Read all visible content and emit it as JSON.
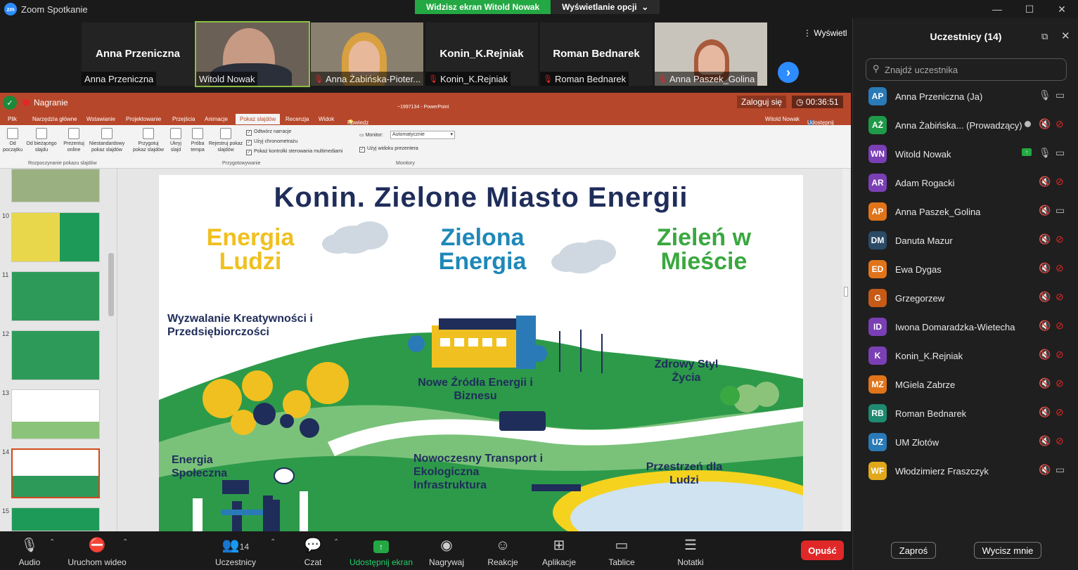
{
  "window": {
    "title": "Zoom Spotkanie"
  },
  "share_banner": {
    "status": "Widzisz ekran Witold Nowak",
    "options": "Wyświetlanie opcji"
  },
  "video_tiles": [
    {
      "big_name": "Anna Przeniczna",
      "label": "Anna Przeniczna",
      "muted": false
    },
    {
      "big_name": "",
      "label": "Witold Nowak",
      "muted": false
    },
    {
      "big_name": "",
      "label": "Anna Żabińska-Pioter...",
      "muted": true
    },
    {
      "big_name": "Konin_K.Rejniak",
      "label": "Konin_K.Rejniak",
      "muted": true
    },
    {
      "big_name": "Roman Bednarek",
      "label": "Roman Bednarek",
      "muted": true
    },
    {
      "big_name": "",
      "label": "Anna Paszek_Golina",
      "muted": true
    }
  ],
  "view_button": "Wyświetl",
  "recording": {
    "label": "Nagranie"
  },
  "ppt": {
    "doc_title": "~1997134 - PowerPoint",
    "login": "Zaloguj się",
    "timer": "00:36:51",
    "user": "Witold Nowak",
    "share": "Udostępnij",
    "tell_me": "Powiedz mi, co chcesz zrobić...",
    "tabs": [
      "Plik",
      "Narzędzia główne",
      "Wstawianie",
      "Projektowanie",
      "Przejścia",
      "Animacje",
      "Pokaz slajdów",
      "Recenzja",
      "Widok"
    ],
    "ribbon": {
      "b1": [
        "Od",
        "początku"
      ],
      "b2": [
        "Od bieżącego",
        "slajdu"
      ],
      "b3": [
        "Prezentuj",
        "online"
      ],
      "b4": [
        "Niestandardowy",
        "pokaz slajdów"
      ],
      "g1": "Rozpoczynanie pokazu slajdów",
      "b5": [
        "Przygotuj",
        "pokaz slajdów"
      ],
      "b6": [
        "Ukryj",
        "slajd"
      ],
      "b7": [
        "Próba",
        "tempa"
      ],
      "b8": [
        "Rejestruj pokaz",
        "slajdów"
      ],
      "c1": "Odtwórz narracje",
      "c2": "Użyj chronometrażu",
      "c3": "Pokaż kontrolki sterowania multimediami",
      "g2": "Przygotowywanie",
      "monitor_label": "Monitor:",
      "monitor_value": "Automatycznie",
      "c4": "Użyj widoku prezentera",
      "g3": "Monitory"
    },
    "thumb_numbers": [
      "10",
      "11",
      "12",
      "13",
      "14",
      "15"
    ]
  },
  "slide": {
    "title": "Konin. Zielone Miasto Energii",
    "col1": "Energia Ludzi",
    "col2": "Zielona Energia",
    "col3": "Zieleń w Mieście",
    "l1": "Wyzwalanie Kreatywności i Przedsiębiorczości",
    "l2": "Nowe Źródła Energii i Biznesu",
    "l3": "Zdrowy Styl Życia",
    "l4": "Energia Społeczna",
    "l5": "Nowoczesny Transport i Ekologiczna Infrastruktura",
    "l6": "Przestrzeń dla Ludzi"
  },
  "toolbar": {
    "audio": "Audio",
    "video": "Uruchom wideo",
    "participants": "Uczestnicy",
    "participants_count": "14",
    "chat": "Czat",
    "share": "Udostępnij ekran",
    "record": "Nagrywaj",
    "reactions": "Reakcje",
    "apps": "Aplikacje",
    "whiteboards": "Tablice",
    "notes": "Notatki",
    "leave": "Opuść"
  },
  "panel": {
    "title": "Uczestnicy (14)",
    "search_placeholder": "Znajdź uczestnika",
    "invite": "Zaproś",
    "mute_all": "Wycisz mnie",
    "participants": [
      {
        "initials": "AP",
        "name": "Anna Przeniczna (Ja)",
        "color": "#2a7ab8",
        "mic": "on",
        "cam": "on"
      },
      {
        "initials": "AŻ",
        "name": "Anna Żabińska... (Prowadzący)",
        "color": "#1e9a48",
        "mic": "off",
        "cam": "off"
      },
      {
        "initials": "WN",
        "name": "Witold Nowak",
        "color": "#7a3fb5",
        "mic": "on",
        "cam": "on"
      },
      {
        "initials": "AR",
        "name": "Adam Rogacki",
        "color": "#7a3fb5",
        "mic": "off",
        "cam": "off"
      },
      {
        "initials": "AP",
        "name": "Anna Paszek_Golina",
        "color": "#e0741a",
        "mic": "off",
        "cam": "on"
      },
      {
        "initials": "DM",
        "name": "Danuta Mazur",
        "color": "#2a4a66",
        "mic": "off",
        "cam": "off"
      },
      {
        "initials": "ED",
        "name": "Ewa Dygas",
        "color": "#e0741a",
        "mic": "off",
        "cam": "off"
      },
      {
        "initials": "G",
        "name": "Grzegorzew",
        "color": "#c65a16",
        "mic": "off",
        "cam": "off"
      },
      {
        "initials": "ID",
        "name": "Iwona Domaradzka-Wietecha",
        "color": "#7a3fb5",
        "mic": "off",
        "cam": "off"
      },
      {
        "initials": "K",
        "name": "Konin_K.Rejniak",
        "color": "#7a3fb5",
        "mic": "off",
        "cam": "off"
      },
      {
        "initials": "MZ",
        "name": "MGiela Zabrze",
        "color": "#e0741a",
        "mic": "off",
        "cam": "off"
      },
      {
        "initials": "RB",
        "name": "Roman Bednarek",
        "color": "#1e8a70",
        "mic": "off",
        "cam": "off"
      },
      {
        "initials": "UZ",
        "name": "UM Złotów",
        "color": "#2a7ab8",
        "mic": "off",
        "cam": "off"
      },
      {
        "initials": "WF",
        "name": "Włodzimierz Fraszczyk",
        "color": "#e0a81a",
        "mic": "off",
        "cam": "on"
      }
    ]
  }
}
